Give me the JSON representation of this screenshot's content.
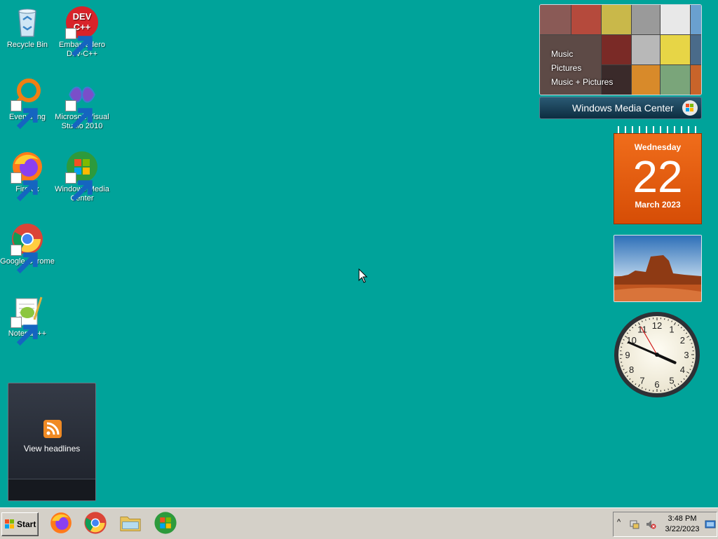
{
  "desktop": {
    "icons": [
      {
        "label": "Recycle Bin",
        "icon": "recycle-bin-icon"
      },
      {
        "label": "Embarcadero Dev-C++",
        "icon": "devcpp-icon",
        "logo_text": "DEV C++"
      },
      {
        "label": "Everything",
        "icon": "everything-icon"
      },
      {
        "label": "Microsoft Visual Studio 2010",
        "icon": "visual-studio-icon"
      },
      {
        "label": "Firefox",
        "icon": "firefox-icon"
      },
      {
        "label": "Windows Media Center",
        "icon": "windows-media-center-icon"
      },
      {
        "label": "Google Chrome",
        "icon": "chrome-icon"
      },
      {
        "label": "Notepad++",
        "icon": "notepadpp-icon"
      }
    ],
    "background_color": "#00A39A"
  },
  "gadgets": {
    "media_center": {
      "menu": [
        "Music",
        "Pictures",
        "Music + Pictures"
      ],
      "title": "Windows Media Center"
    },
    "calendar": {
      "weekday": "Wednesday",
      "day": "22",
      "month": "March 2023"
    },
    "clock": {
      "hour": 3,
      "minute": 48,
      "second": 55
    },
    "feed": {
      "label": "View headlines"
    }
  },
  "taskbar": {
    "start_label": "Start",
    "pinned": [
      "firefox-icon",
      "chrome-icon",
      "file-explorer-icon",
      "windows-media-center-icon"
    ],
    "tray": {
      "time": "3:48 PM",
      "date": "3/22/2023"
    }
  }
}
